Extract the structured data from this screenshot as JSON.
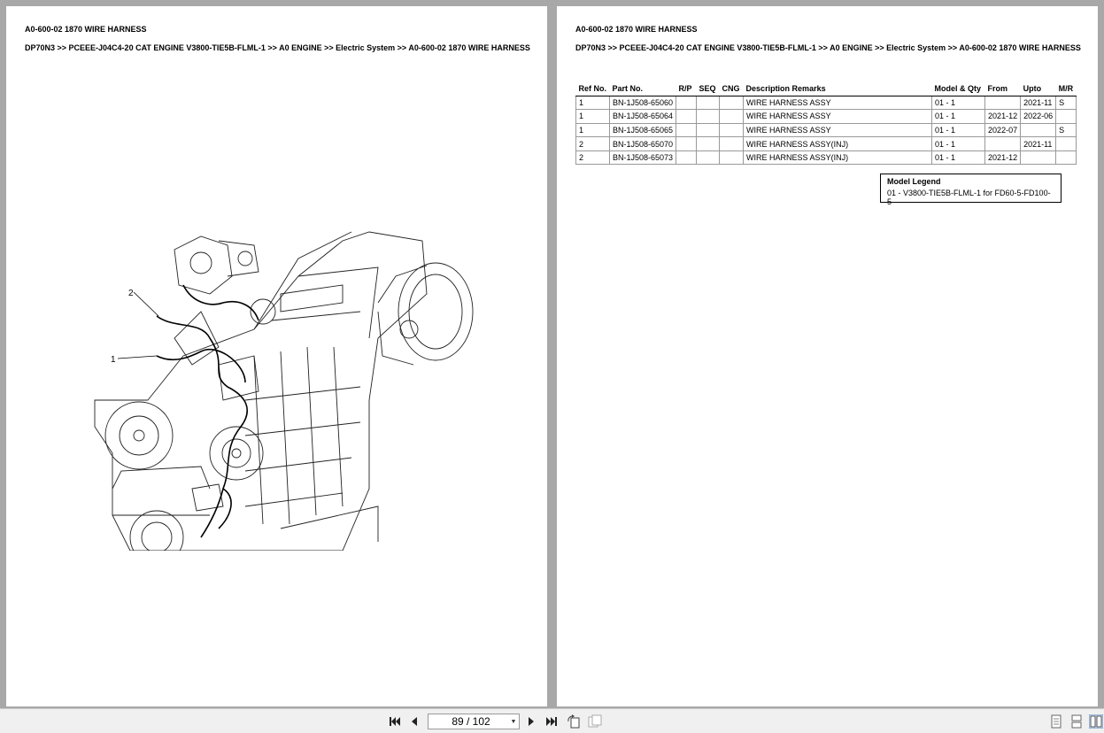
{
  "left_page": {
    "title": "A0-600-02 1870 WIRE HARNESS",
    "breadcrumb": "DP70N3 >> PCEEE-J04C4-20 CAT ENGINE V3800-TIE5B-FLML-1 >> A0 ENGINE >> Electric System >> A0-600-02 1870 WIRE HARNESS",
    "callouts": [
      "1",
      "2"
    ]
  },
  "right_page": {
    "title": "A0-600-02 1870 WIRE HARNESS",
    "breadcrumb": "DP70N3 >> PCEEE-J04C4-20 CAT ENGINE V3800-TIE5B-FLML-1 >> A0 ENGINE >> Electric System >> A0-600-02 1870 WIRE HARNESS",
    "table": {
      "headers": [
        "Ref No.",
        "Part No.",
        "R/P",
        "SEQ",
        "CNG",
        "Description Remarks",
        "Model & Qty",
        "From",
        "Upto",
        "M/R"
      ],
      "rows": [
        [
          "1",
          "BN-1J508-65060",
          "",
          "",
          "",
          "WIRE HARNESS ASSY",
          "01 - 1",
          "",
          "2021-11",
          "S"
        ],
        [
          "1",
          "BN-1J508-65064",
          "",
          "",
          "",
          "WIRE HARNESS ASSY",
          "01 - 1",
          "2021-12",
          "2022-06",
          ""
        ],
        [
          "1",
          "BN-1J508-65065",
          "",
          "",
          "",
          "WIRE HARNESS ASSY",
          "01 - 1",
          "2022-07",
          "",
          "S"
        ],
        [
          "2",
          "BN-1J508-65070",
          "",
          "",
          "",
          "WIRE HARNESS ASSY(INJ)",
          "01 - 1",
          "",
          "2021-11",
          ""
        ],
        [
          "2",
          "BN-1J508-65073",
          "",
          "",
          "",
          "WIRE HARNESS ASSY(INJ)",
          "01 - 1",
          "2021-12",
          "",
          ""
        ]
      ]
    },
    "legend": {
      "title": "Model Legend",
      "entry": "01 - V3800-TIE5B-FLML-1 for FD60-5-FD100-5"
    }
  },
  "toolbar": {
    "page_indicator": "89 / 102",
    "icons": [
      "first-page-icon",
      "prev-page-icon",
      "next-page-icon",
      "last-page-icon",
      "rotate-icon",
      "fit-icon",
      "single-page-view-icon",
      "continuous-view-icon",
      "two-page-view-icon"
    ]
  }
}
